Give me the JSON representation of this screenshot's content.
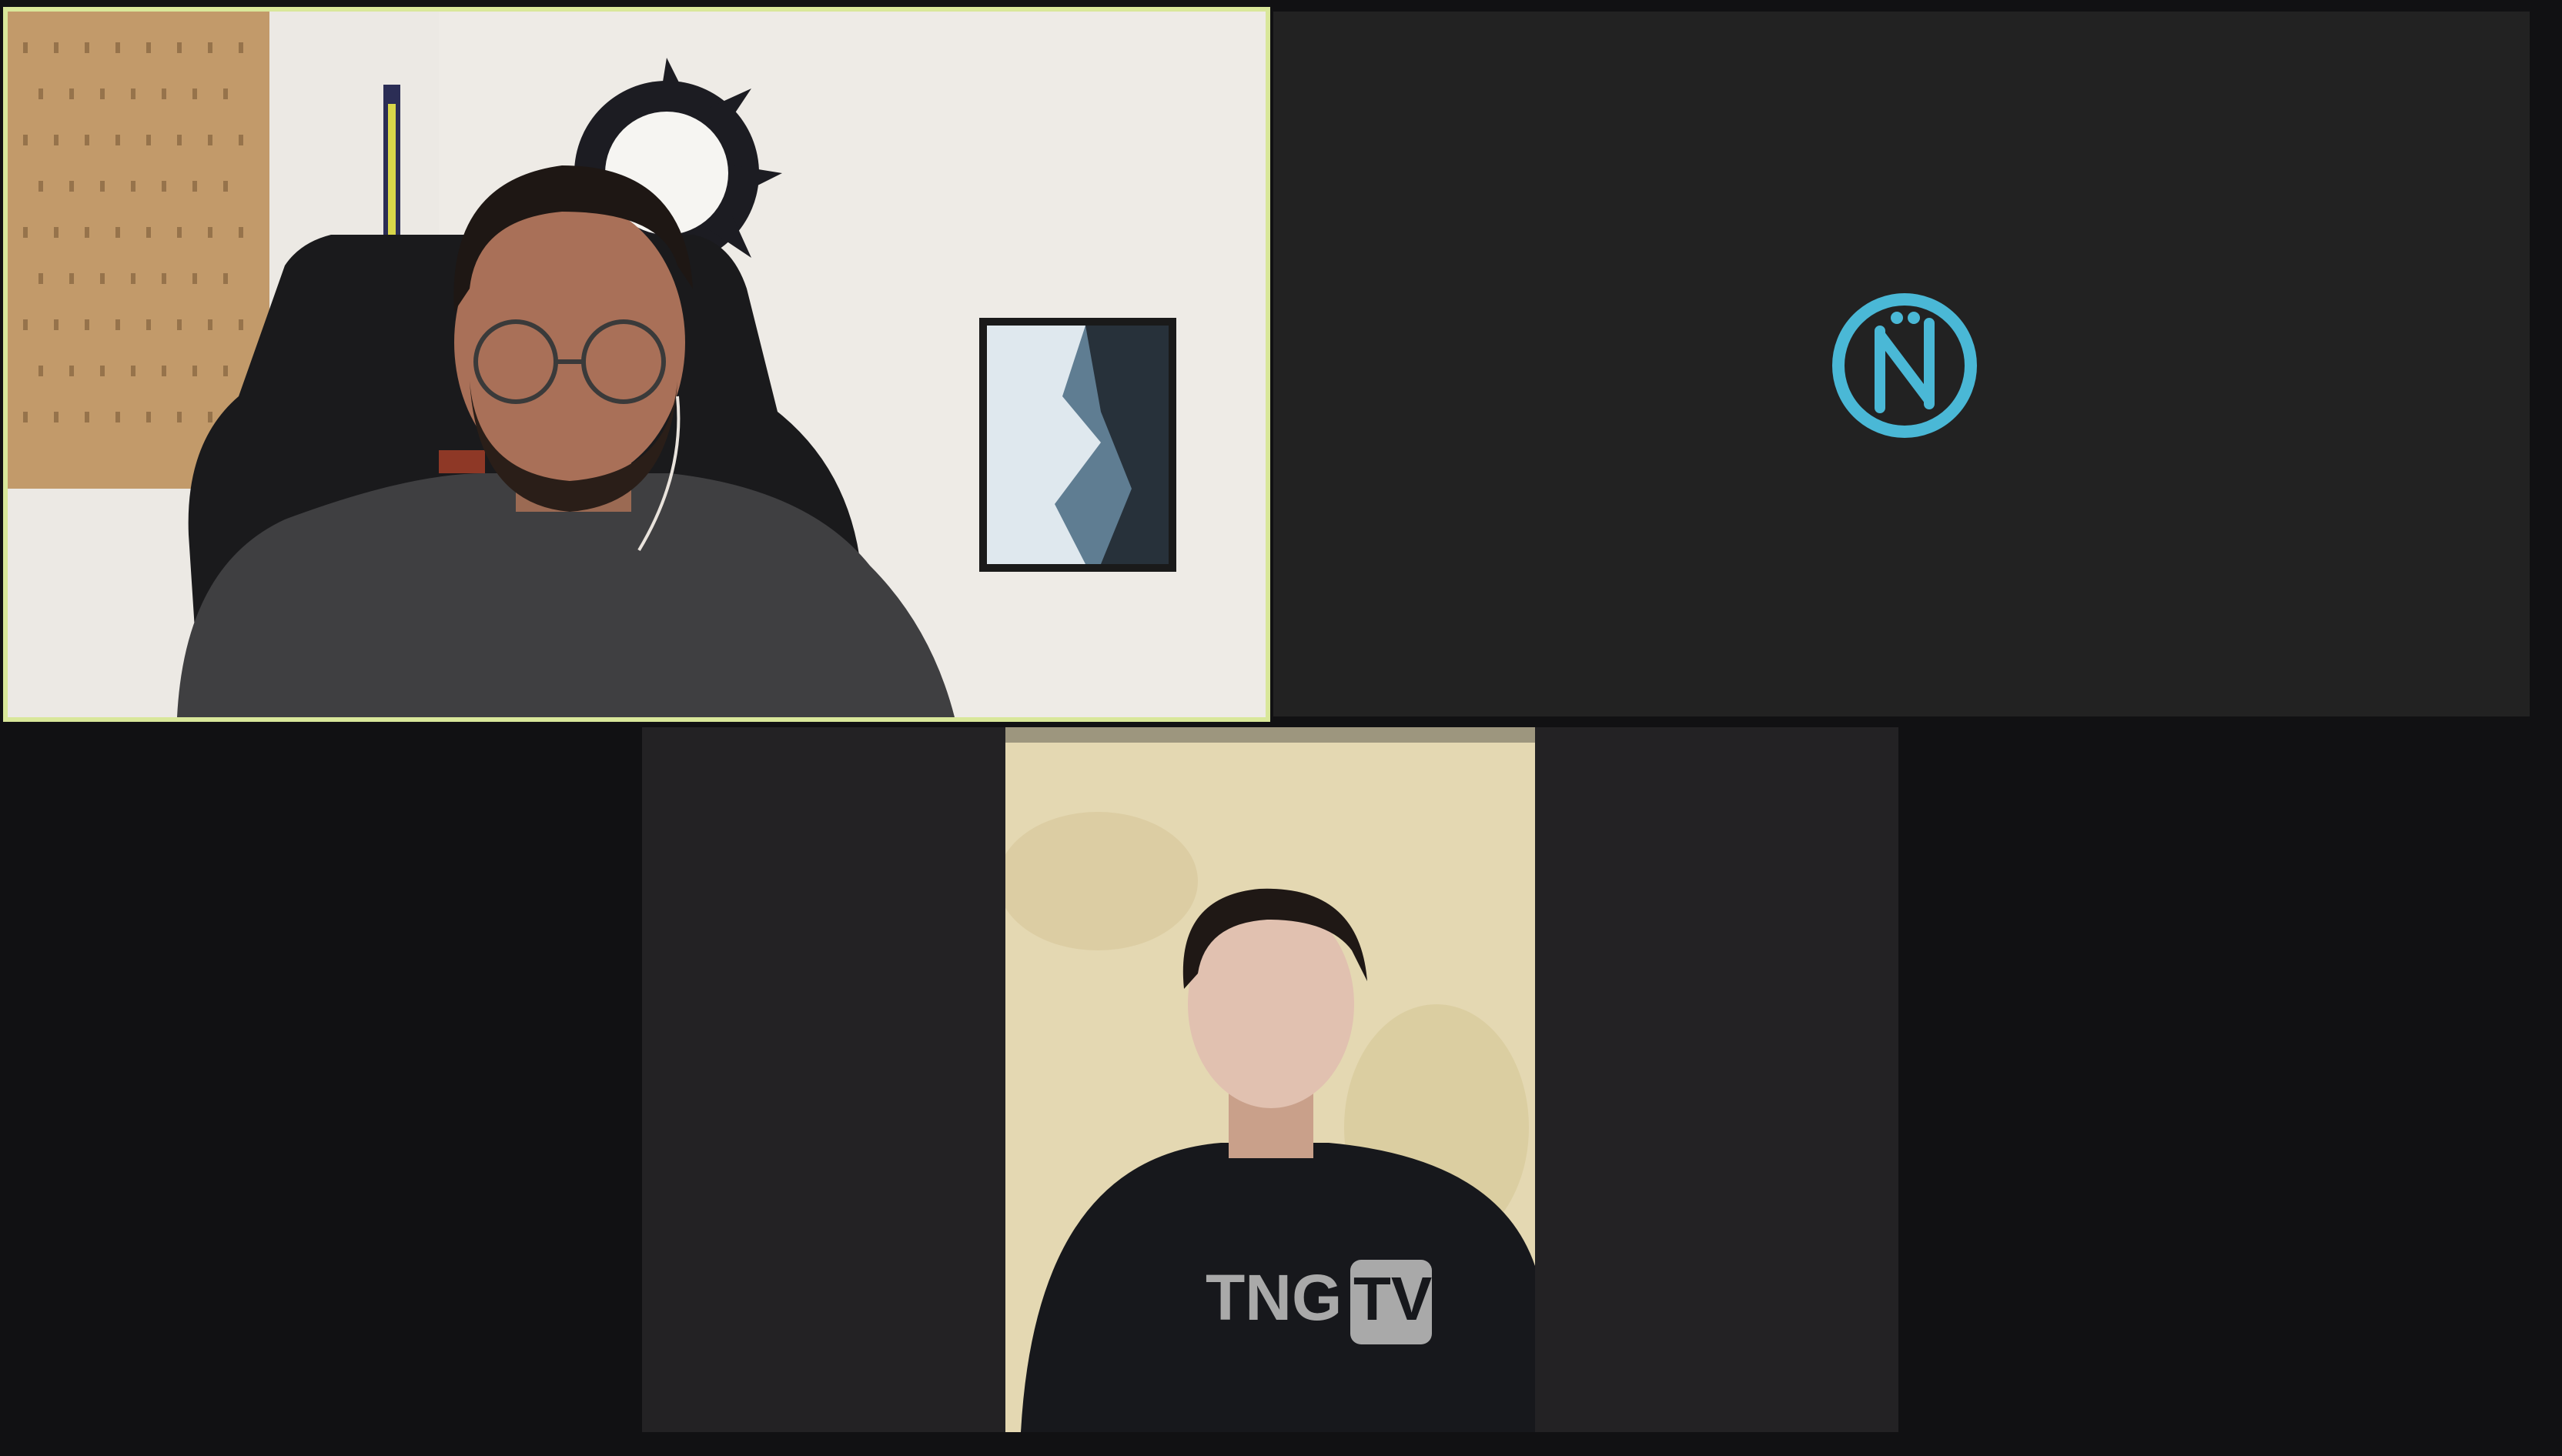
{
  "app": {
    "layout": "gallery-view",
    "participant_count": 3
  },
  "participants": [
    {
      "id": "tile-1",
      "active_speaker": true,
      "video_on": true,
      "highlight_color": "#d9e79a"
    },
    {
      "id": "tile-2",
      "active_speaker": false,
      "video_on": false,
      "avatar_icon": "nw-logo-icon",
      "avatar_color": "#4ab8d6"
    },
    {
      "id": "tile-3",
      "active_speaker": false,
      "video_on": true,
      "shirt_text": {
        "left": "TNG",
        "right": "TV"
      }
    }
  ],
  "colors": {
    "background": "#111113",
    "tile_background": "#222222"
  }
}
